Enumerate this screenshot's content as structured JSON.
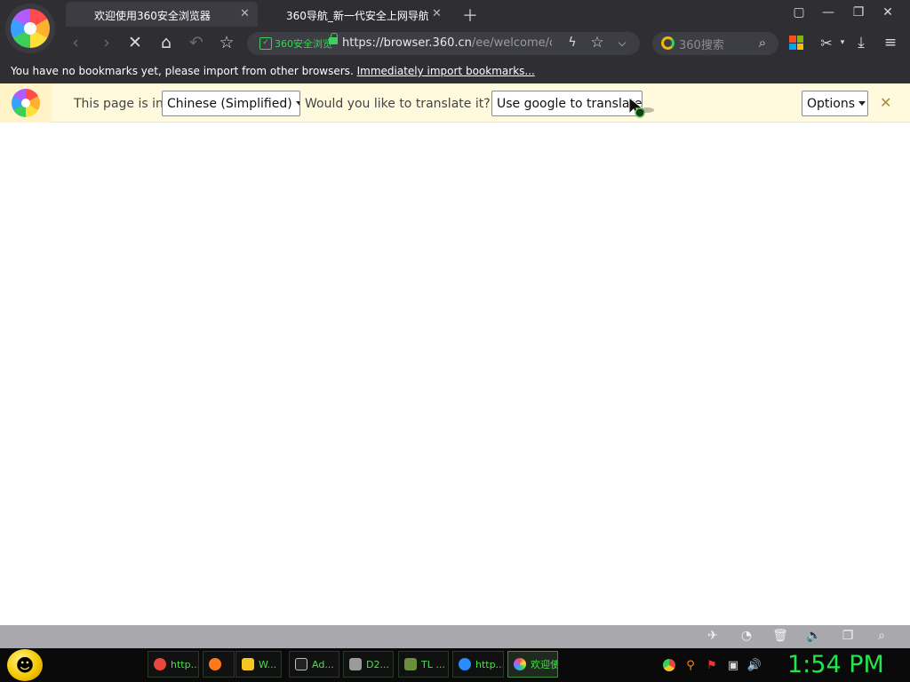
{
  "browser": {
    "tabs": [
      {
        "label": "欢迎使用360安全浏览器"
      },
      {
        "label": "360导航_新一代安全上网导航"
      }
    ],
    "new_tab_icon": "plus-icon",
    "window_controls": [
      "skin-icon",
      "minimize-icon",
      "restore-icon",
      "close-icon"
    ]
  },
  "toolbar": {
    "safe_badge": "360安全浏览",
    "url_host": "https://browser.360.cn",
    "url_path": "/ee/welcome/chi",
    "search_placeholder": "360搜索"
  },
  "bookmarks_bar": {
    "message": "You have no bookmarks yet, please import from other browsers.",
    "link": "Immediately import bookmarks..."
  },
  "translate_bar": {
    "page_is_in": "This page is in",
    "language": "Chinese (Simplified)",
    "question": "Would you like to translate it?",
    "translate_button": "Use google to translate",
    "options_button": "Options"
  },
  "taskbar": {
    "items": [
      {
        "label": "http...",
        "icon": "chrome-icon",
        "color": "#e8453c"
      },
      {
        "label": "",
        "icon": "firefox-icon",
        "color": "#ff7a18"
      },
      {
        "label": "W...",
        "icon": "folder-icon",
        "color": "#f3c623"
      },
      {
        "label": "Ad...",
        "icon": "terminal-icon",
        "color": "#c0c0c0"
      },
      {
        "label": "D2...",
        "icon": "app-icon",
        "color": "#9a9a9a"
      },
      {
        "label": "TL ...",
        "icon": "minecraft-icon",
        "color": "#6b8e3a"
      },
      {
        "label": "http...",
        "icon": "browser-icon",
        "color": "#2a8cff"
      },
      {
        "label": "欢迎使...",
        "icon": "360-browser-icon",
        "color": "#b05cff"
      }
    ],
    "clock": "1:54 PM"
  },
  "colors": {
    "accent_green": "#27e34c",
    "translate_bar_bg": "#fff9de",
    "chrome_bg": "#2e2e33"
  }
}
